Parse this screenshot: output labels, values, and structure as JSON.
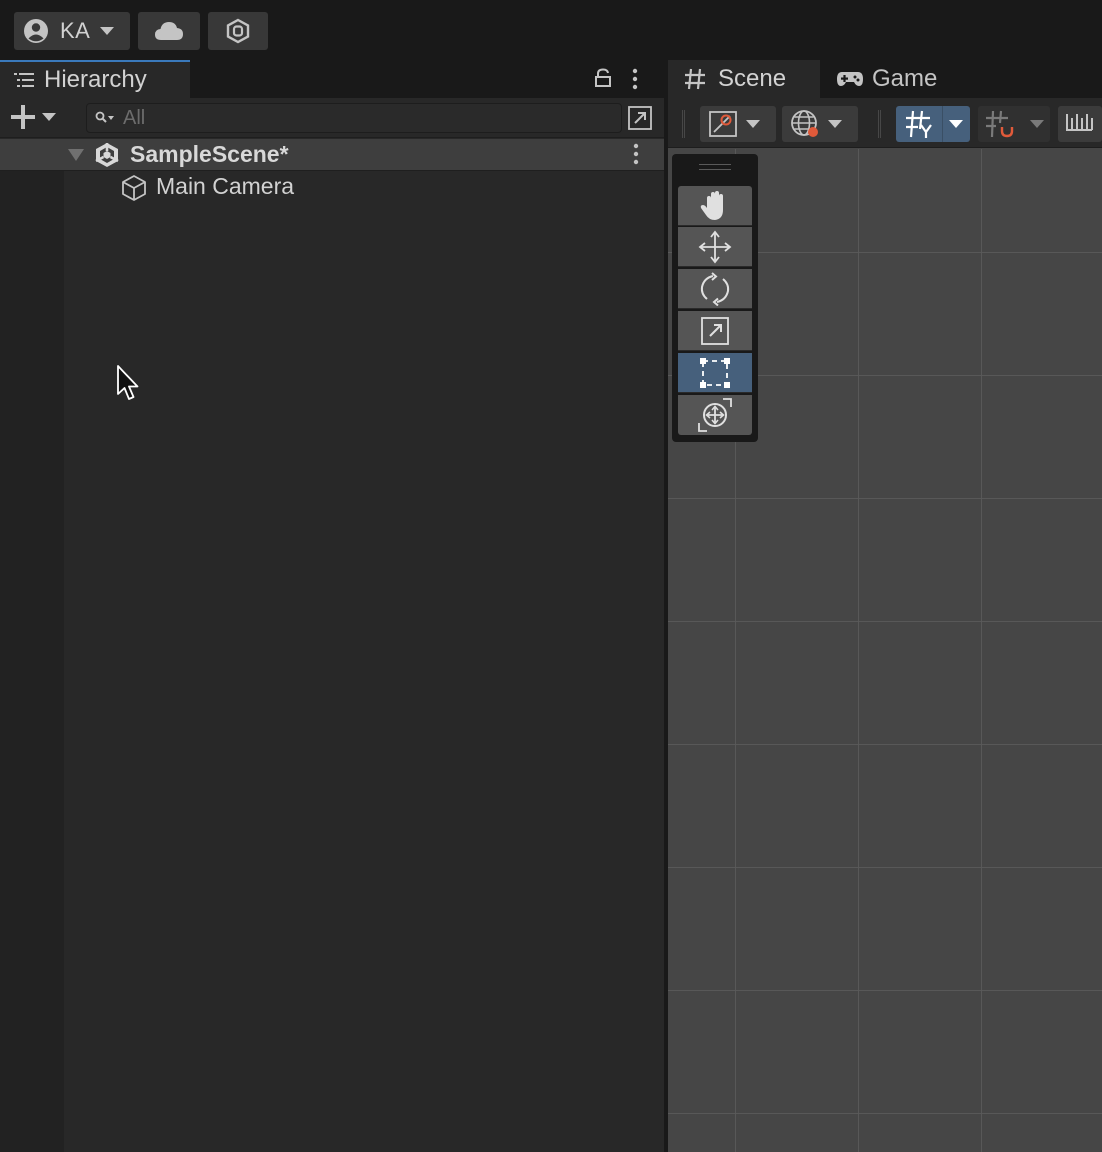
{
  "top_toolbar": {
    "account_label": "KA",
    "icons": [
      "account-icon",
      "chevron-down-icon",
      "cloud-icon",
      "collab-icon"
    ]
  },
  "hierarchy": {
    "tab_label": "Hierarchy",
    "search_placeholder": "All",
    "search_value": "",
    "tree": {
      "scene_name": "SampleScene*",
      "children": [
        {
          "label": "Main Camera"
        }
      ]
    }
  },
  "scene_panel": {
    "tabs": [
      {
        "label": "Scene",
        "active": true
      },
      {
        "label": "Game",
        "active": false
      }
    ],
    "tools": [
      {
        "name": "hand-tool",
        "active": false
      },
      {
        "name": "move-tool",
        "active": false
      },
      {
        "name": "rotate-tool",
        "active": false
      },
      {
        "name": "scale-tool",
        "active": false
      },
      {
        "name": "rect-tool",
        "active": true
      },
      {
        "name": "transform-tool",
        "active": false
      }
    ]
  },
  "colors": {
    "accent": "#3a79bb",
    "active_button": "#46607c",
    "panel_bg": "#282828",
    "scene_bg": "#464646"
  }
}
